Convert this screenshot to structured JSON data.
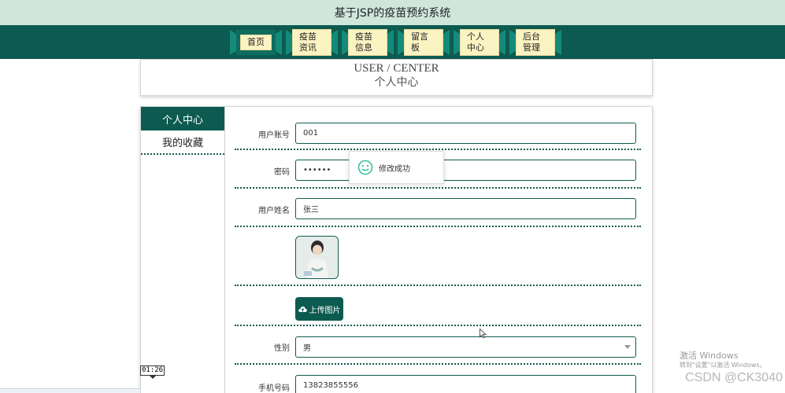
{
  "app": {
    "title": "基于JSP的疫苗预约系统"
  },
  "nav": {
    "items": [
      {
        "label": "首页"
      },
      {
        "label": "疫苗资讯"
      },
      {
        "label": "疫苗信息"
      },
      {
        "label": "留言板"
      },
      {
        "label": "个人中心"
      },
      {
        "label": "后台管理"
      }
    ]
  },
  "header": {
    "title_en": "USER / CENTER",
    "title_cn": "个人中心"
  },
  "sidebar": {
    "items": [
      {
        "label": "个人中心",
        "active": true
      },
      {
        "label": "我的收藏",
        "active": false
      }
    ]
  },
  "form": {
    "account": {
      "label": "用户账号",
      "value": "001"
    },
    "password": {
      "label": "密码",
      "value": "••••••"
    },
    "name": {
      "label": "用户姓名",
      "value": "张三"
    },
    "upload": {
      "label": "上传图片"
    },
    "gender": {
      "label": "性别",
      "value": "男"
    },
    "phone": {
      "label": "手机号码",
      "value": "13823855556"
    }
  },
  "toast": {
    "message": "修改成功"
  },
  "overlay": {
    "windows_title": "激活 Windows",
    "windows_sub": "转到\"设置\"以激活 Windows。",
    "csdn": "CSDN @CK3040",
    "time": "01:26"
  },
  "colors": {
    "primary": "#0d5b50",
    "topbar": "#cfe6dc",
    "nav_label_bg": "#fbf3c2"
  }
}
